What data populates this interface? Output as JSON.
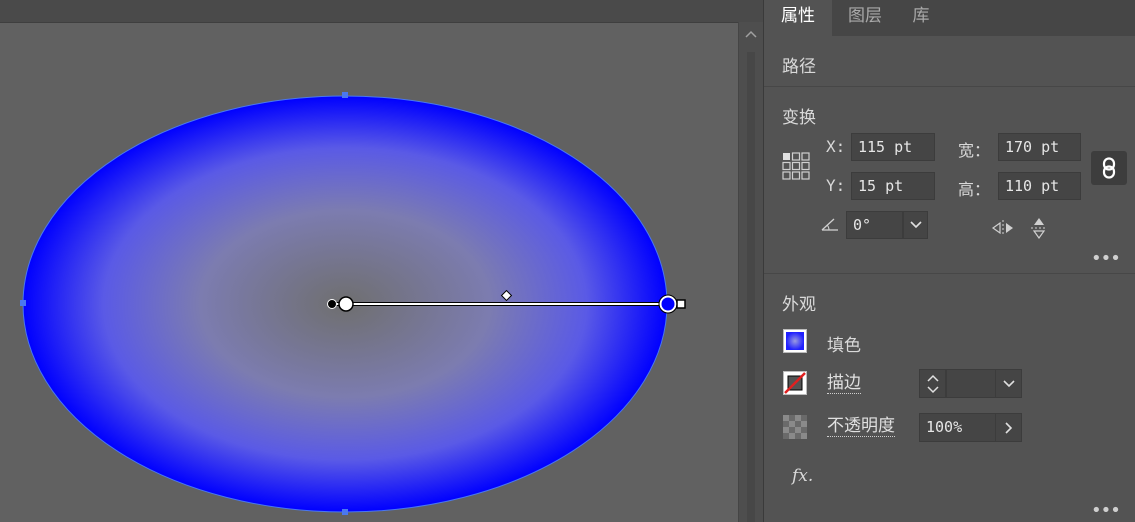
{
  "tabs": [
    {
      "label": "属性",
      "active": true
    },
    {
      "label": "图层",
      "active": false
    },
    {
      "label": "库",
      "active": false
    }
  ],
  "panel": {
    "section_path": "路径",
    "section_transform": "变换",
    "transform": {
      "x_label": "X:",
      "x_value": "115 pt",
      "y_label": "Y:",
      "y_value": "15 pt",
      "width_label": "宽：",
      "width_value": "170 pt",
      "height_label": "高：",
      "height_value": "110 pt",
      "rotation_value": "0°"
    },
    "section_appearance": "外观",
    "appearance": {
      "fill_label": "填色",
      "stroke_label": "描边",
      "opacity_label": "不透明度",
      "opacity_value": "100%",
      "fx_label": "fx."
    }
  },
  "colors": {
    "gradient_center": "#6f6f6f",
    "gradient_edge": "#0000ff",
    "canvas_bg": "#616161",
    "panel_bg": "#535353",
    "selection_blue": "#3f7df0"
  }
}
